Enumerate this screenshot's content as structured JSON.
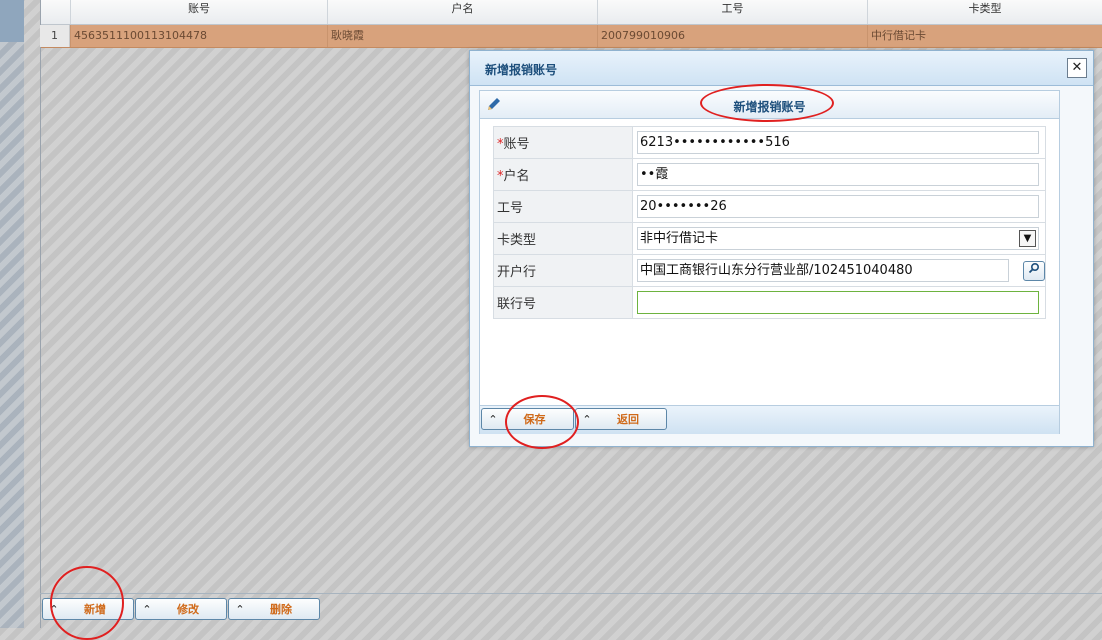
{
  "grid": {
    "headers": [
      "账号",
      "户名",
      "工号",
      "卡类型"
    ],
    "row": {
      "num": "1",
      "account": "4563511100113104478",
      "name": "耿晓霞",
      "employee_id": "200799010906",
      "card_type": "中行借记卡"
    }
  },
  "toolbar": {
    "add": "新增",
    "edit": "修改",
    "delete": "删除"
  },
  "dialog": {
    "title": "新增报销账号",
    "panel_title": "新增报销账号",
    "close_icon": "close-icon",
    "fields": {
      "account_label": "账号",
      "account_value": "6213••••••••••••516",
      "name_label": "户名",
      "name_value": "••霞",
      "employee_label": "工号",
      "employee_value": "20•••••••26",
      "cardtype_label": "卡类型",
      "cardtype_value": "非中行借记卡",
      "bank_label": "开户行",
      "bank_value": "中国工商银行山东分行营业部/102451040480",
      "bankno_label": "联行号",
      "bankno_value": ""
    },
    "buttons": {
      "save": "保存",
      "back": "返回"
    }
  },
  "colors": {
    "accent": "#1d4f7c",
    "button_text": "#d06a1a",
    "selected_row": "#d8a27c",
    "annotation": "#e02020"
  }
}
